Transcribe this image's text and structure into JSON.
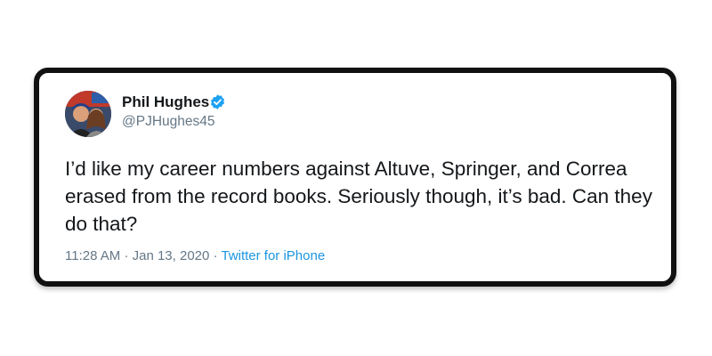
{
  "tweet": {
    "author": {
      "name": "Phil Hughes",
      "handle": "@PJHughes45",
      "verified": true,
      "avatar_icon": "profile-photo"
    },
    "text": "I’d like my career numbers against Altuve, Springer, and Correa erased from the record books. Seriously though, it’s bad. Can they do that?",
    "time": "11:28 AM",
    "date": "Jan 13, 2020",
    "separator": "·",
    "source": "Twitter for iPhone"
  },
  "colors": {
    "border": "#111111",
    "text": "#14171a",
    "muted": "#657786",
    "link": "#1b95e0",
    "verified": "#1da1f2"
  }
}
